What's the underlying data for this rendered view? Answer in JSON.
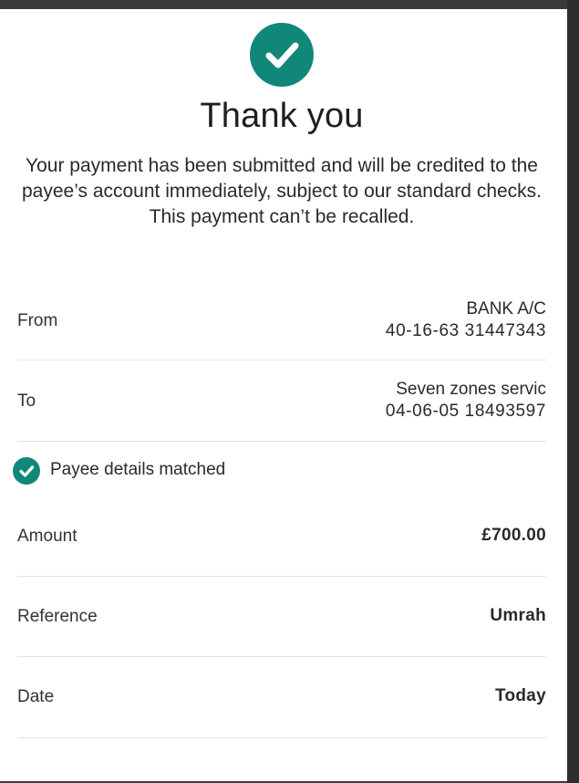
{
  "confirmation": {
    "icon": "check-circle-icon",
    "accent_color": "#11877a",
    "title": "Thank you",
    "message": "Your payment has been submitted and will be credited to the payee’s account immediately, subject to our standard checks. This payment can’t be recalled."
  },
  "details": {
    "from": {
      "label": "From",
      "account_name": "BANK A/C",
      "account_number": "40-16-63 31447343"
    },
    "to": {
      "label": "To",
      "payee_name": "Seven zones servic",
      "account_number": "04-06-05 18493597"
    },
    "payee_match": {
      "icon": "check-circle-icon",
      "text": "Payee details matched"
    },
    "amount": {
      "label": "Amount",
      "value": "£700.00"
    },
    "reference": {
      "label": "Reference",
      "value": "Umrah"
    },
    "date": {
      "label": "Date",
      "value": "Today"
    }
  }
}
